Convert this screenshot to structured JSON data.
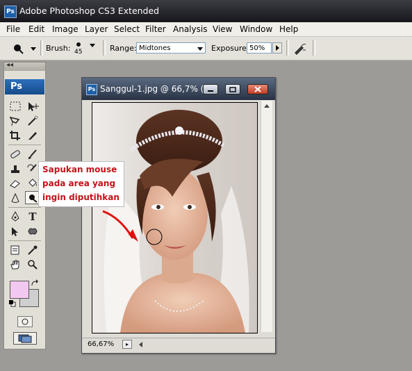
{
  "app": {
    "title": "Adobe Photoshop CS3 Extended",
    "badge": "Ps"
  },
  "menu": [
    "File",
    "Edit",
    "Image",
    "Layer",
    "Select",
    "Filter",
    "Analysis",
    "View",
    "Window",
    "Help"
  ],
  "options": {
    "brush_label": "Brush:",
    "brush_size": "45",
    "range_label": "Range:",
    "range_value": "Midtones",
    "exposure_label": "Exposure:",
    "exposure_value": "50%"
  },
  "toolbox": {
    "collapse": "◂◂",
    "badge": "Ps"
  },
  "colors": {
    "foreground": "#f3c8f0",
    "background": "#cfcfcf",
    "annotation_text": "#c7111a"
  },
  "document": {
    "title": "Sanggul-1.jpg @ 66,7% (...",
    "badge": "Ps",
    "zoom": "66,67%"
  },
  "annotation": {
    "line1": "Sapukan mouse",
    "line2": "pada area yang",
    "line3": "ingin diputihkan"
  }
}
